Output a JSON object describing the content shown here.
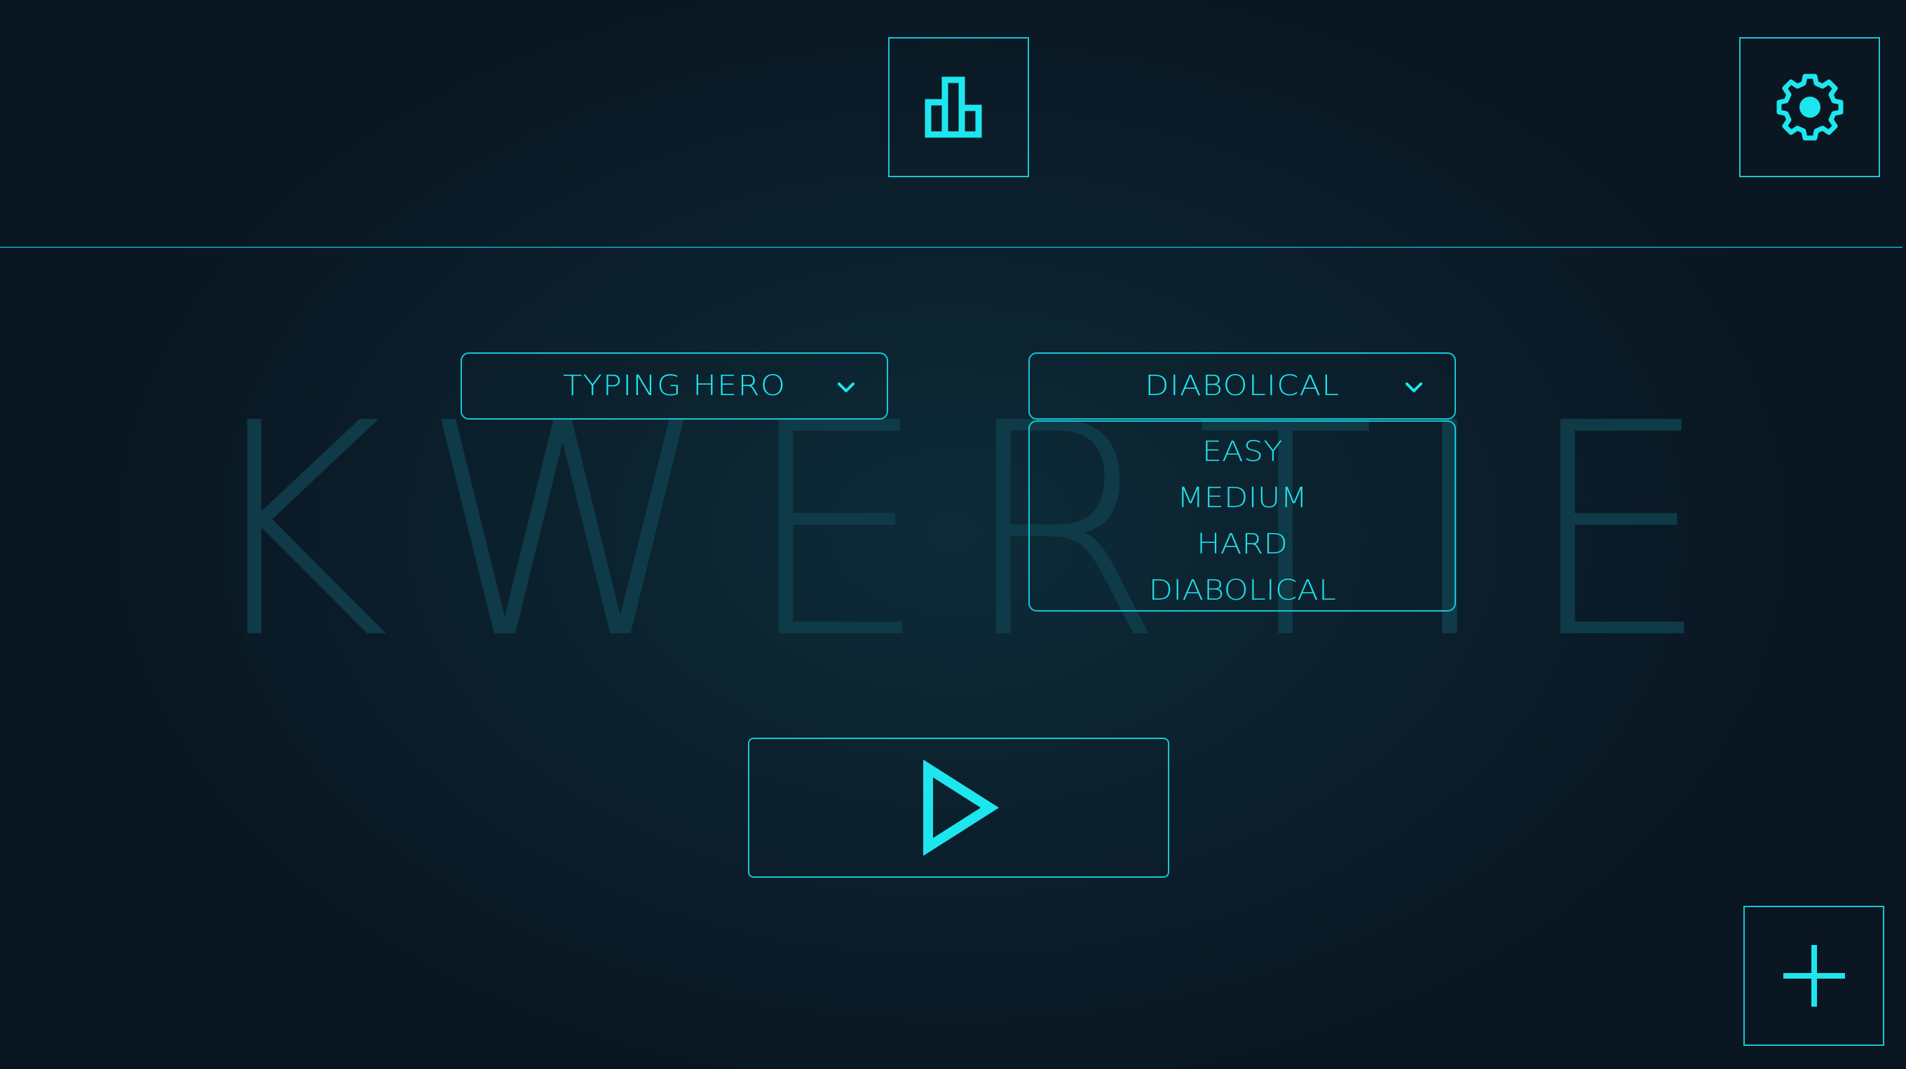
{
  "watermark": {
    "letters": [
      "K",
      "W",
      "E",
      "R",
      "T",
      "I",
      "E"
    ]
  },
  "toolbar": {
    "leaderboard_icon": "bar-chart-icon",
    "settings_icon": "gear-icon",
    "add_icon": "plus-icon"
  },
  "mode_select": {
    "selected": "TYPING HERO",
    "icon": "chevron-down-icon"
  },
  "difficulty_select": {
    "selected": "DIABOLICAL",
    "icon": "chevron-down-icon",
    "options": [
      "EASY",
      "MEDIUM",
      "HARD",
      "DIABOLICAL"
    ]
  },
  "play": {
    "icon": "play-icon"
  },
  "colors": {
    "accent": "#1ee6ee",
    "border": "#17c6d4",
    "background": "#0a1621",
    "watermark": "#0f3a47"
  }
}
